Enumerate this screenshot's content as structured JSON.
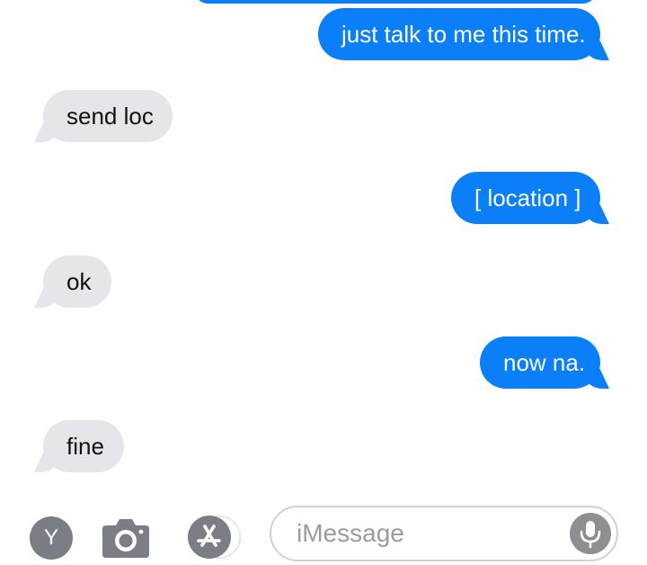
{
  "messages": [
    {
      "direction": "sent",
      "text": "just talk to me this time."
    },
    {
      "direction": "received",
      "text": "send loc"
    },
    {
      "direction": "sent",
      "text": "[ location ]"
    },
    {
      "direction": "received",
      "text": "ok"
    },
    {
      "direction": "sent",
      "text": "now na."
    },
    {
      "direction": "received",
      "text": "fine"
    }
  ],
  "composer": {
    "avatar_letter": "Y",
    "placeholder": "iMessage",
    "icons": {
      "avatar": "y-avatar-icon",
      "camera": "camera-icon",
      "apps": "app-store-icon",
      "mic": "microphone-icon"
    }
  },
  "colors": {
    "sent_bubble": "#0b7ff7",
    "received_bubble": "#e5e5ea",
    "sent_text": "#ffffff",
    "received_text": "#111111",
    "icon_gray": "#7b7e86"
  }
}
